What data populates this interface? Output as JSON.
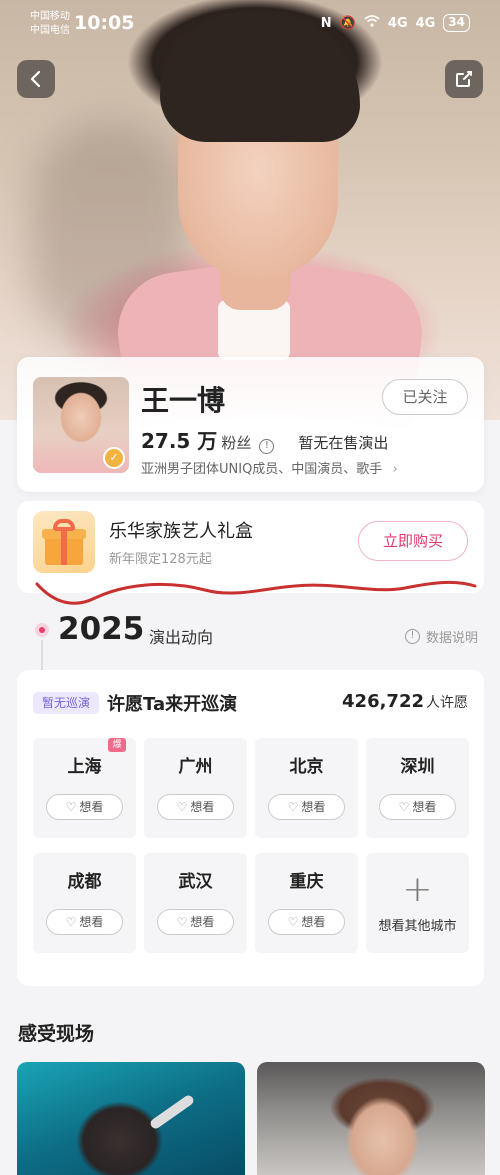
{
  "status_bar": {
    "carrier_1": "中国移动",
    "carrier_2": "中国电信",
    "time": "10:05",
    "signal_1": "4G",
    "signal_2": "4G",
    "battery": "34"
  },
  "header": {
    "back_icon": "chevron-left-icon",
    "share_icon": "share-icon"
  },
  "artist": {
    "name": "王一博",
    "follow_label": "已关注",
    "fans_count": "27.5 万",
    "fans_label": "粉丝",
    "sale_status": "暂无在售演出",
    "tags": "亚洲男子团体UNIQ成员、中国演员、歌手"
  },
  "gift": {
    "title": "乐华家族艺人礼盒",
    "subtitle": "新年限定128元起",
    "buy_label": "立即购买"
  },
  "timeline": {
    "year": "2025",
    "label": "演出动向",
    "data_note": "数据说明"
  },
  "tour": {
    "badge": "暂无巡演",
    "title": "许愿Ta来开巡演",
    "wish_count": "426,722",
    "wish_unit": "人许愿",
    "want_label": "想看",
    "hot_label": "爆",
    "cities": [
      "上海",
      "广州",
      "北京",
      "深圳",
      "成都",
      "武汉",
      "重庆"
    ],
    "more_label": "想看其他城市"
  },
  "live": {
    "title": "感受现场"
  },
  "colors": {
    "accent": "#e2386e",
    "badge_purple": "#7a63d8",
    "annotation_red": "#c8312f"
  }
}
